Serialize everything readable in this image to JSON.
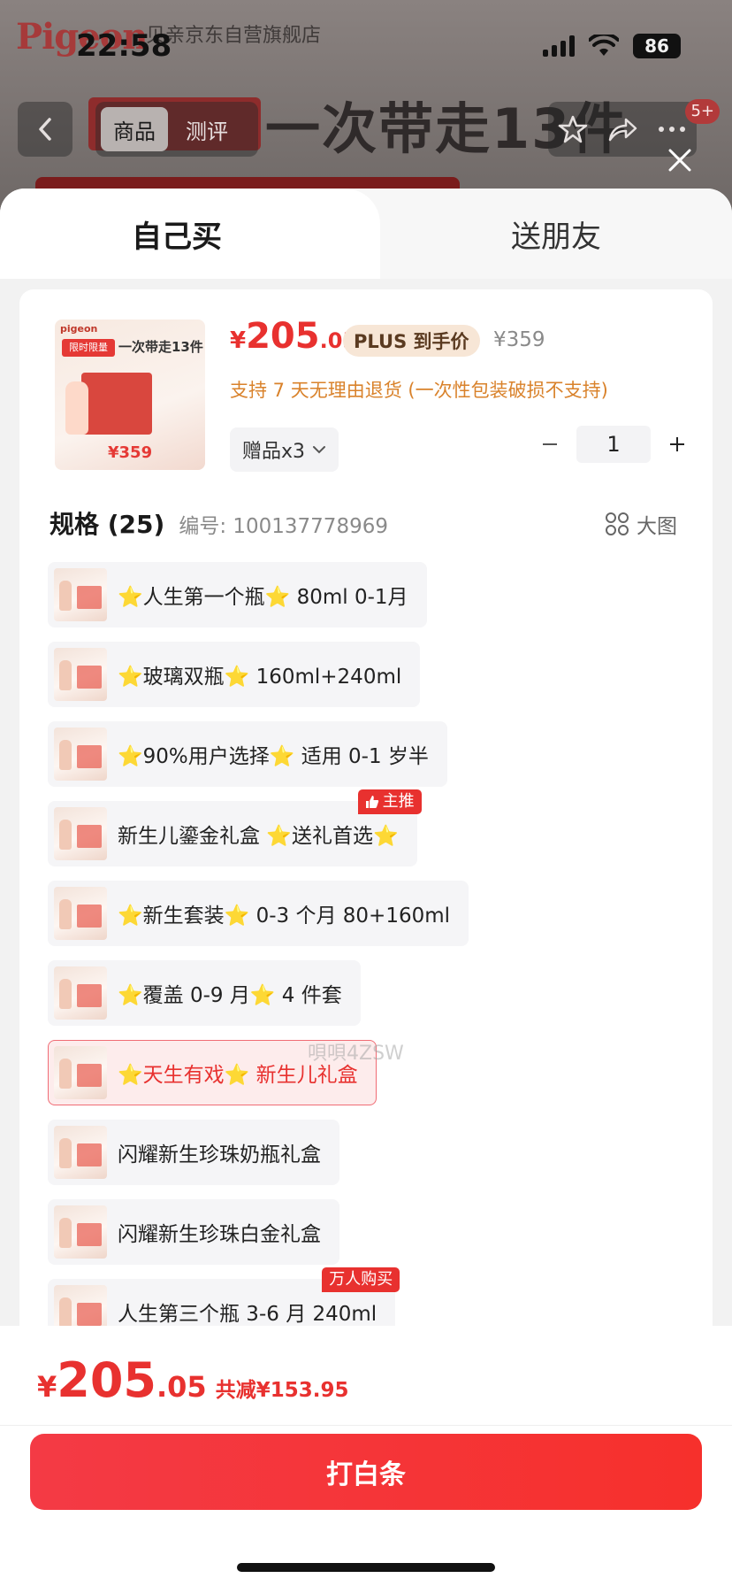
{
  "status_bar": {
    "time": "22:58",
    "battery": "86"
  },
  "background": {
    "brand": "Pigeon",
    "store_name": "贝亲京东自营旗舰店",
    "banner_text": "一次带走13件",
    "nav_tabs": [
      "商品",
      "测评"
    ],
    "cart_badge": "5+"
  },
  "tabs": {
    "self": "自己买",
    "friend": "送朋友"
  },
  "product": {
    "price_currency": "¥",
    "price_int": "205",
    "price_dec": ".05",
    "plus_tag": "PLUS 到手价",
    "original_price": "¥359",
    "return_policy": "支持 7 天无理由退货 (一次性包装破损不支持)",
    "gift": "赠品x3",
    "quantity": "1",
    "thumb_brand": "pigeon",
    "thumb_badge": "限时限量",
    "thumb_title": "一次带走13件",
    "thumb_price": "¥359"
  },
  "spec": {
    "title": "规格 (25)",
    "code": "编号: 100137778969",
    "big_view": "大图",
    "items": [
      {
        "label": "⭐人生第一个瓶⭐ 80ml 0-1月",
        "tag": ""
      },
      {
        "label": "⭐玻璃双瓶⭐  160ml+240ml",
        "tag": ""
      },
      {
        "label": "⭐90%用户选择⭐  适用 0-1 岁半",
        "tag": ""
      },
      {
        "label": "新生儿鎏金礼盒  ⭐送礼首选⭐",
        "tag": "主推"
      },
      {
        "label": "⭐新生套装⭐  0-3 个月 80+160ml",
        "tag": ""
      },
      {
        "label": "⭐覆盖 0-9 月⭐  4 件套",
        "tag": ""
      },
      {
        "label": "⭐天生有戏⭐  新生儿礼盒",
        "tag": ""
      },
      {
        "label": "闪耀新生珍珠奶瓶礼盒",
        "tag": ""
      },
      {
        "label": "闪耀新生珍珠白金礼盒",
        "tag": ""
      },
      {
        "label": "人生第三个瓶  3-6 月 240ml",
        "tag": "万人购买"
      }
    ]
  },
  "watermark": "唄唄4ZSW",
  "footer": {
    "price_currency": "¥",
    "price_int": "205",
    "price_dec": ".05",
    "savings": "共减¥153.95",
    "pay_button": "打白条"
  },
  "colors": {
    "accent": "#e8312f",
    "orange": "#d9822b",
    "selected_bg": "#fdecec"
  }
}
